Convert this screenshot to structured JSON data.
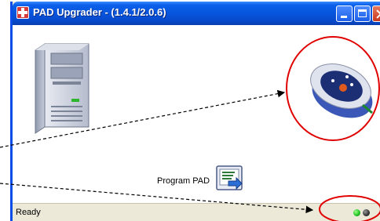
{
  "window": {
    "title": "PAD Upgrader - (1.4.1/2.0.6)",
    "controls": [
      "minimize",
      "maximize",
      "close"
    ]
  },
  "main": {
    "program_label": "Program PAD",
    "icons": {
      "computer": "server-tower-icon",
      "device": "aed-device-icon",
      "program": "program-pad-icon"
    }
  },
  "statusbar": {
    "text": "Ready",
    "leds": [
      {
        "name": "green-led",
        "color": "#22c022"
      },
      {
        "name": "gray-led",
        "color": "#333333"
      }
    ]
  },
  "annotations": {
    "circle_color": "#e00000",
    "arrow_color": "#000000"
  }
}
